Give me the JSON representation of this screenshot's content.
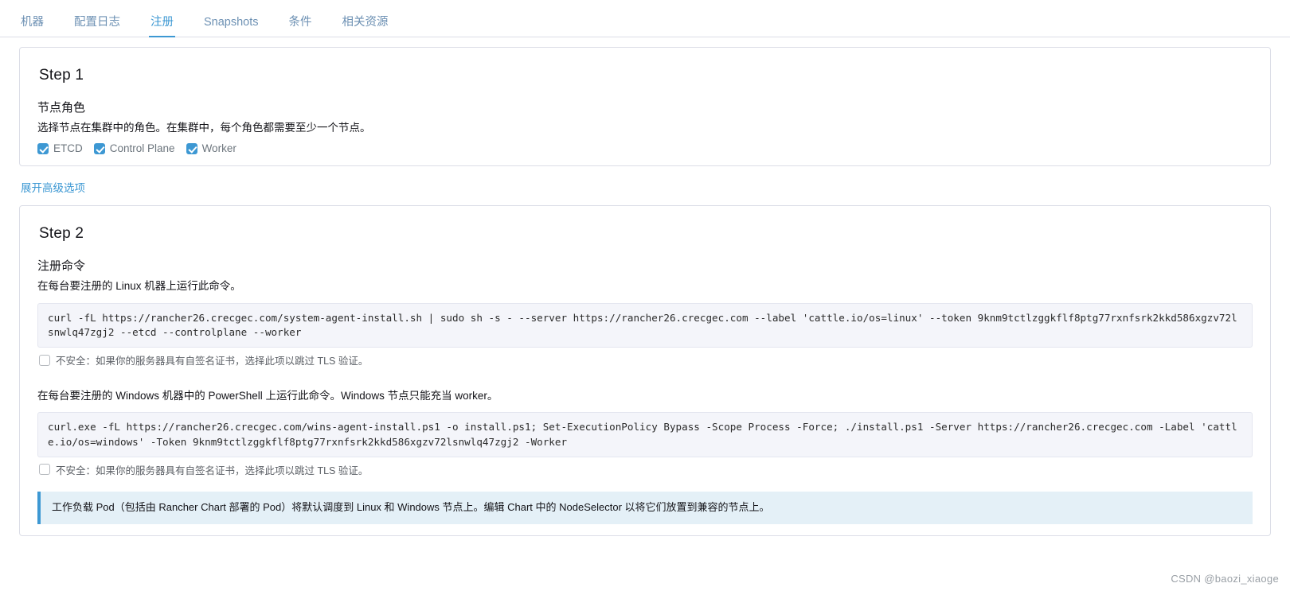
{
  "tabs": [
    {
      "label": "机器",
      "active": false
    },
    {
      "label": "配置日志",
      "active": false
    },
    {
      "label": "注册",
      "active": true
    },
    {
      "label": "Snapshots",
      "active": false
    },
    {
      "label": "条件",
      "active": false
    },
    {
      "label": "相关资源",
      "active": false
    }
  ],
  "step1": {
    "title": "Step 1",
    "section_title": "节点角色",
    "description": "选择节点在集群中的角色。在集群中，每个角色都需要至少一个节点。",
    "roles": [
      {
        "label": "ETCD",
        "checked": true
      },
      {
        "label": "Control Plane",
        "checked": true
      },
      {
        "label": "Worker",
        "checked": true
      }
    ]
  },
  "advanced_link": "展开高级选项",
  "step2": {
    "title": "Step 2",
    "section_title": "注册命令",
    "linux_instruction": "在每台要注册的 Linux 机器上运行此命令。",
    "linux_command": "curl -fL https://rancher26.crecgec.com/system-agent-install.sh | sudo sh -s - --server https://rancher26.crecgec.com --label 'cattle.io/os=linux' --token 9knm9tctlzggkflf8ptg77rxnfsrk2kkd586xgzv72lsnwlq47zgj2 --etcd --controlplane --worker",
    "linux_insecure": {
      "label": "不安全：如果你的服务器具有自签名证书，选择此项以跳过 TLS 验证。",
      "checked": false
    },
    "windows_instruction": "在每台要注册的 Windows 机器中的 PowerShell 上运行此命令。Windows 节点只能充当 worker。",
    "windows_command": "curl.exe -fL https://rancher26.crecgec.com/wins-agent-install.ps1 -o install.ps1; Set-ExecutionPolicy Bypass -Scope Process -Force; ./install.ps1 -Server https://rancher26.crecgec.com -Label 'cattle.io/os=windows' -Token 9knm9tctlzggkflf8ptg77rxnfsrk2kkd586xgzv72lsnwlq47zgj2 -Worker",
    "windows_insecure": {
      "label": "不安全：如果你的服务器具有自签名证书，选择此项以跳过 TLS 验证。",
      "checked": false
    },
    "banner": "工作负载 Pod（包括由 Rancher Chart 部署的 Pod）将默认调度到 Linux 和 Windows 节点上。编辑 Chart 中的 NodeSelector 以将它们放置到兼容的节点上。"
  },
  "watermark": "CSDN @baozi_xiaoge",
  "colors": {
    "accent": "#3d98d3",
    "tab_inactive": "#6c90b3",
    "code_bg": "#f4f5fa",
    "banner_bg": "#e4f0f7",
    "border": "#dcdee7"
  }
}
